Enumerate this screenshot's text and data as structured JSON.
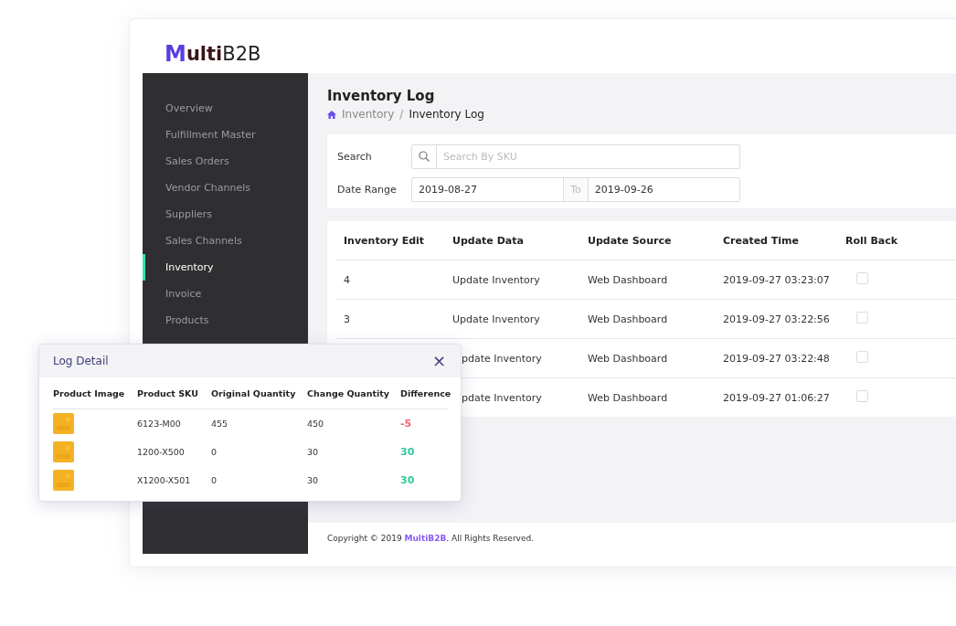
{
  "logo": {
    "mark": "M",
    "strong": "ulti",
    "light": "B2B"
  },
  "sidebar": {
    "items": [
      {
        "label": "Overview",
        "selected": false
      },
      {
        "label": "Fulfillment Master",
        "selected": false
      },
      {
        "label": "Sales Orders",
        "selected": false
      },
      {
        "label": "Vendor Channels",
        "selected": false
      },
      {
        "label": "Suppliers",
        "selected": false
      },
      {
        "label": "Sales Channels",
        "selected": false
      },
      {
        "label": "Inventory",
        "selected": true
      },
      {
        "label": "Invoice",
        "selected": false
      },
      {
        "label": "Products",
        "selected": false
      }
    ]
  },
  "page": {
    "title": "Inventory Log",
    "breadcrumb": [
      "Inventory",
      "Inventory Log"
    ],
    "breadcrumb_separator": "/"
  },
  "filters": {
    "search_label": "Search",
    "search_placeholder": "Search By SKU",
    "date_label": "Date Range",
    "date_from": "2019-08-27",
    "date_sep": "To",
    "date_to": "2019-09-26"
  },
  "table": {
    "columns": [
      "Inventory Edit",
      "Update Data",
      "Update Source",
      "Created Time",
      "Roll Back"
    ],
    "rows": [
      {
        "edit": "4",
        "data": "Update Inventory",
        "source": "Web Dashboard",
        "time": "2019-09-27 03:23:07",
        "checked": false
      },
      {
        "edit": "3",
        "data": "Update Inventory",
        "source": "Web Dashboard",
        "time": "2019-09-27 03:22:56",
        "checked": false
      },
      {
        "data": "pdate Inventory",
        "source": "Web Dashboard",
        "time": "2019-09-27 03:22:48",
        "checked": false
      },
      {
        "data": "pdate Inventory",
        "source": "Web Dashboard",
        "time": "2019-09-27 01:06:27",
        "checked": false
      }
    ]
  },
  "footer": {
    "before": "Copyright © 2019 ",
    "brand": "MultiB2B",
    "after": ". All Rights Reserved."
  },
  "dialog": {
    "title": "Log Detail",
    "close": "×",
    "columns": [
      "Product Image",
      "Product SKU",
      "Original Quantity",
      "Change Quantity",
      "Difference"
    ],
    "rows": [
      {
        "kind": "picture",
        "sku": "6123-M00",
        "original": "455",
        "change": "450",
        "difference": "-5",
        "color": "#f0606a"
      },
      {
        "kind": "picture",
        "sku": "1200-X500",
        "original": "0",
        "change": "30",
        "difference": "30",
        "color": "#2ec99a"
      },
      {
        "kind": "picture",
        "sku": "X1200-X501",
        "original": "0",
        "change": "30",
        "difference": "30",
        "color": "#2ec99a"
      }
    ]
  }
}
